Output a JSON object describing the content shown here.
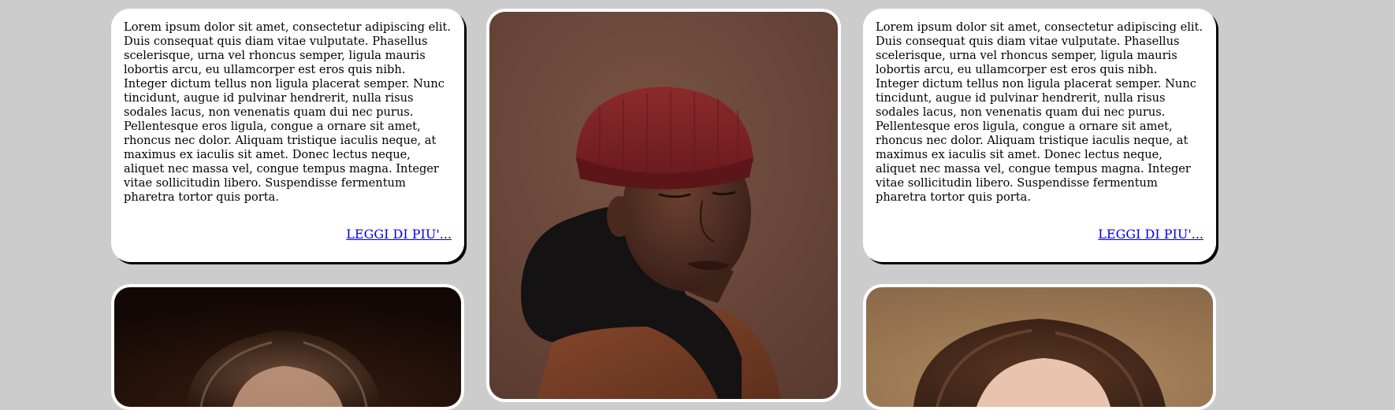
{
  "cards": {
    "left_text": {
      "body": "Lorem ipsum dolor sit amet, consectetur adipiscing elit. Duis consequat quis diam vitae vulputate. Phasellus scelerisque, urna vel rhoncus semper, ligula mauris lobortis arcu, eu ullamcorper est eros quis nibh. Integer dictum tellus non ligula placerat semper. Nunc tincidunt, augue id pulvinar hendrerit, nulla risus sodales lacus, non venenatis quam dui nec purus. Pellentesque eros ligula, congue a ornare sit amet, rhoncus nec dolor. Aliquam tristique iaculis neque, at maximus ex iaculis sit amet. Donec lectus neque, aliquet nec massa vel, congue tempus magna. Integer vitae sollicitudin libero. Suspendisse fermentum pharetra tortor quis porta.",
      "link": "LEGGI DI PIU'..."
    },
    "right_text": {
      "body": "Lorem ipsum dolor sit amet, consectetur adipiscing elit. Duis consequat quis diam vitae vulputate. Phasellus scelerisque, urna vel rhoncus semper, ligula mauris lobortis arcu, eu ullamcorper est eros quis nibh. Integer dictum tellus non ligula placerat semper. Nunc tincidunt, augue id pulvinar hendrerit, nulla risus sodales lacus, non venenatis quam dui nec purus. Pellentesque eros ligula, congue a ornare sit amet, rhoncus nec dolor. Aliquam tristique iaculis neque, at maximus ex iaculis sit amet. Donec lectus neque, aliquet nec massa vel, congue tempus magna. Integer vitae sollicitudin libero. Suspendisse fermentum pharetra tortor quis porta.",
      "link": "LEGGI DI PIU'..."
    }
  },
  "colors": {
    "page_background": "#cccccc",
    "card_background": "#ffffff",
    "link": "#0000ee"
  }
}
